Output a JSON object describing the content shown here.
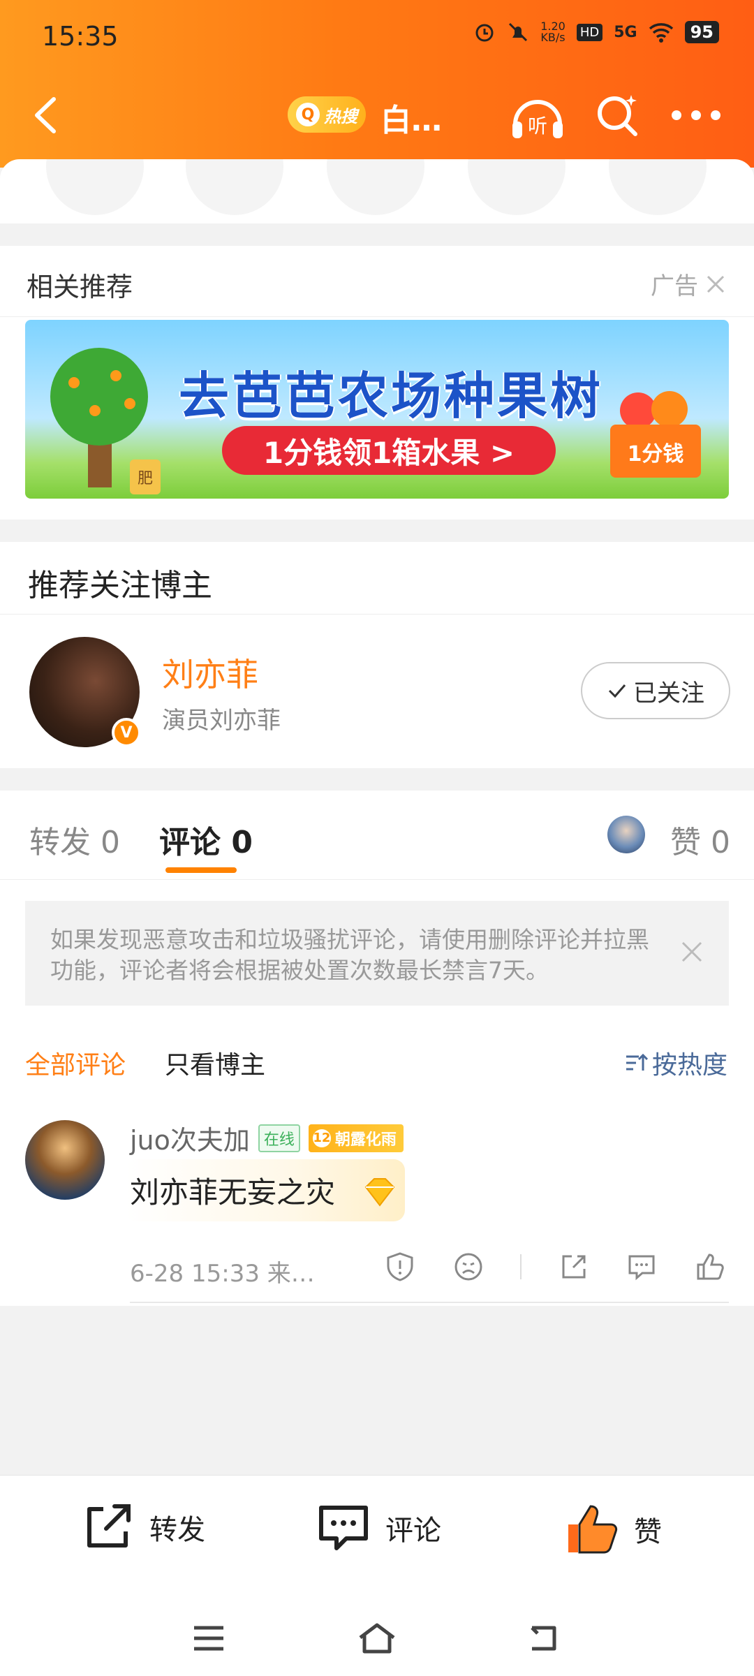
{
  "status_bar": {
    "time": "15:35",
    "speed_top": "1.20",
    "speed_bottom": "KB/s",
    "hd": "HD",
    "network": "5G",
    "battery": "95"
  },
  "nav": {
    "hot_label": "热搜",
    "title": "白…",
    "listen_label": "听"
  },
  "recommend": {
    "title": "相关推荐",
    "ad_label": "广告",
    "banner_title": "去芭芭农场种果树",
    "banner_pill": "1分钱领1箱水果 >",
    "banner_box": "1分钱",
    "banner_tag": "肥"
  },
  "follow": {
    "title": "推荐关注博主",
    "name": "刘亦菲",
    "desc": "演员刘亦菲",
    "button": "已关注",
    "badge": "V"
  },
  "tabs": {
    "repost": "转发 0",
    "comment": "评论 0",
    "like": "赞 0"
  },
  "comments": {
    "notice": "如果发现恶意攻击和垃圾骚扰评论，请使用删除评论并拉黑功能，评论者将会根据被处置次数最长禁言7天。",
    "filter_all": "全部评论",
    "filter_author": "只看博主",
    "sort": "按热度",
    "items": [
      {
        "user": "juo次夫加",
        "online": "在线",
        "level": "12",
        "level_title": "朝露化雨",
        "text": "刘亦菲无妄之灾",
        "meta": "6-28 15:33  来…"
      }
    ]
  },
  "bottom_bar": {
    "repost": "转发",
    "comment": "评论",
    "like": "赞"
  },
  "colors": {
    "accent": "#ff7f16",
    "header_start": "#ff9a1f",
    "header_end": "#ff5e14"
  }
}
